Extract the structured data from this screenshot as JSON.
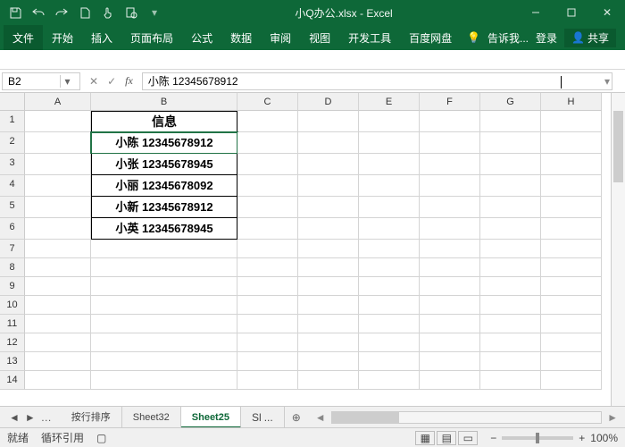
{
  "title": "小Q办公.xlsx - Excel",
  "qat_icons": [
    "save",
    "undo",
    "redo",
    "new",
    "touch",
    "preview"
  ],
  "win": {
    "close_label": "✕"
  },
  "ribbon": {
    "file": "文件",
    "tabs": [
      "开始",
      "插入",
      "页面布局",
      "公式",
      "数据",
      "审阅",
      "视图",
      "开发工具",
      "百度网盘"
    ],
    "tell": "告诉我...",
    "login": "登录",
    "share": "共享"
  },
  "namebox": "B2",
  "formula": "小陈 12345678912",
  "columns": [
    "A",
    "B",
    "C",
    "D",
    "E",
    "F",
    "G",
    "H"
  ],
  "rows": [
    "1",
    "2",
    "3",
    "4",
    "5",
    "6",
    "7",
    "8",
    "9",
    "10",
    "11",
    "12",
    "13",
    "14"
  ],
  "data": {
    "B1": "信息",
    "B2": "小陈 12345678912",
    "B3": "小张 12345678945",
    "B4": "小丽 12345678092",
    "B5": "小新 12345678912",
    "B6": "小英 12345678945"
  },
  "sheets": {
    "nav": [
      "◄",
      "►",
      "…"
    ],
    "tabs": [
      "按行排序",
      "Sheet32",
      "Sheet25",
      "Sl"
    ],
    "active": 2,
    "more": "..."
  },
  "status": {
    "ready": "就绪",
    "ref": "循环引用",
    "zoom": "100%"
  }
}
